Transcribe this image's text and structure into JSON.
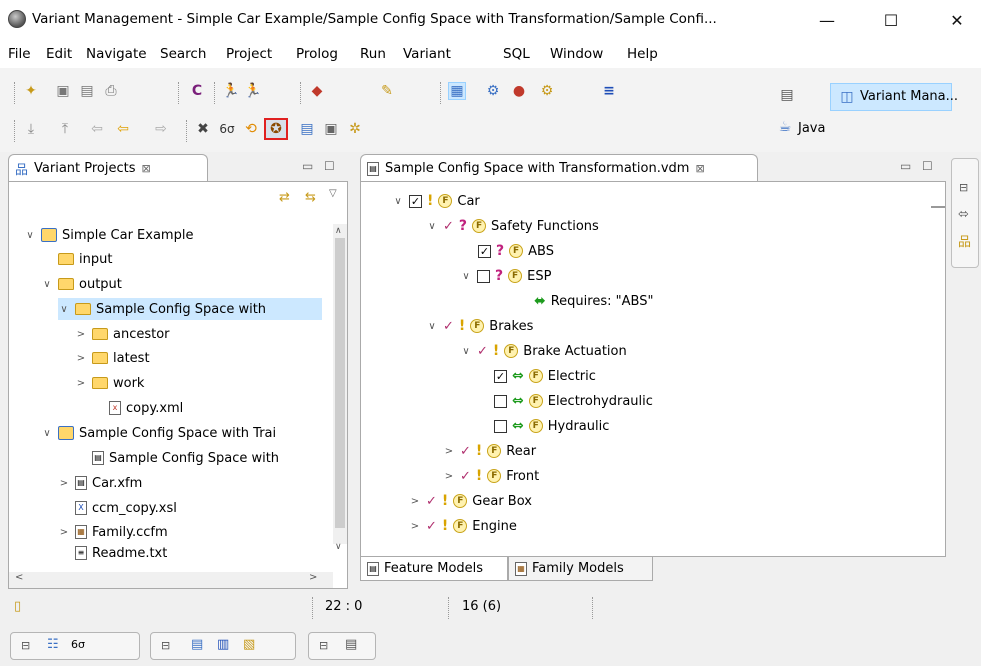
{
  "window": {
    "title": "Variant Management - Simple Car Example/Sample Config Space with Transformation/Sample Confi...",
    "min_label": "—",
    "max_label": "☐",
    "close_label": "✕"
  },
  "menu": [
    "File",
    "Edit",
    "Navigate",
    "Search",
    "Project",
    "Prolog",
    "Run",
    "Variant",
    "SQL",
    "Window",
    "Help"
  ],
  "perspectives": {
    "active": "Variant Mana...",
    "other": "Java"
  },
  "left_view": {
    "tab_label": "Variant Projects",
    "tab_close": "⊠",
    "tree": [
      {
        "label": "Simple Car Example",
        "twisty": "∨",
        "icon": "project"
      },
      {
        "label": "input",
        "twisty": "",
        "icon": "folder"
      },
      {
        "label": "output",
        "twisty": "∨",
        "icon": "folder"
      },
      {
        "label": "Sample Config Space with",
        "twisty": "∨",
        "icon": "folder"
      },
      {
        "label": "ancestor",
        "twisty": ">",
        "icon": "folder"
      },
      {
        "label": "latest",
        "twisty": ">",
        "icon": "folder"
      },
      {
        "label": "work",
        "twisty": ">",
        "icon": "folder"
      },
      {
        "label": "copy.xml",
        "twisty": "",
        "icon": "xml"
      },
      {
        "label": "Sample Config Space with Trai",
        "twisty": "∨",
        "icon": "project"
      },
      {
        "label": "Sample Config Space with",
        "twisty": "",
        "icon": "doc"
      },
      {
        "label": "Car.xfm",
        "twisty": ">",
        "icon": "doc"
      },
      {
        "label": "ccm_copy.xsl",
        "twisty": "",
        "icon": "doc"
      },
      {
        "label": "Family.ccfm",
        "twisty": ">",
        "icon": "doc"
      },
      {
        "label": "Readme.txt",
        "twisty": "",
        "icon": "doc"
      }
    ]
  },
  "editor": {
    "tab_label": "Sample Config Space with Transformation.vdm",
    "tab_close": "⊠",
    "tree": [
      {
        "label": "Car",
        "twisty": "∨",
        "mark": "cb-checked",
        "kind": "!"
      },
      {
        "label": "Safety Functions",
        "twisty": "∨",
        "mark": "check",
        "kind": "?"
      },
      {
        "label": "ABS",
        "twisty": "",
        "mark": "cb-checked",
        "kind": "?"
      },
      {
        "label": "ESP",
        "twisty": "∨",
        "mark": "cb",
        "kind": "?"
      },
      {
        "label": "Requires: \"ABS\"",
        "twisty": "",
        "mark": "arrow",
        "kind": ""
      },
      {
        "label": "Brakes",
        "twisty": "∨",
        "mark": "check",
        "kind": "!"
      },
      {
        "label": "Brake Actuation",
        "twisty": "∨",
        "mark": "check",
        "kind": "!"
      },
      {
        "label": "Electric",
        "twisty": "",
        "mark": "cb-checked",
        "kind": "⇔"
      },
      {
        "label": "Electrohydraulic",
        "twisty": "",
        "mark": "cb",
        "kind": "⇔"
      },
      {
        "label": "Hydraulic",
        "twisty": "",
        "mark": "cb",
        "kind": "⇔"
      },
      {
        "label": "Rear",
        "twisty": ">",
        "mark": "check",
        "kind": "!"
      },
      {
        "label": "Front",
        "twisty": ">",
        "mark": "check",
        "kind": "!"
      },
      {
        "label": "Gear Box",
        "twisty": ">",
        "mark": "check",
        "kind": "!"
      },
      {
        "label": "Engine",
        "twisty": ">",
        "mark": "check",
        "kind": "!"
      }
    ],
    "bottom_tabs": [
      "Feature Models",
      "Family Models"
    ]
  },
  "status": {
    "position": "22 : 0",
    "count": "16 (6)"
  }
}
